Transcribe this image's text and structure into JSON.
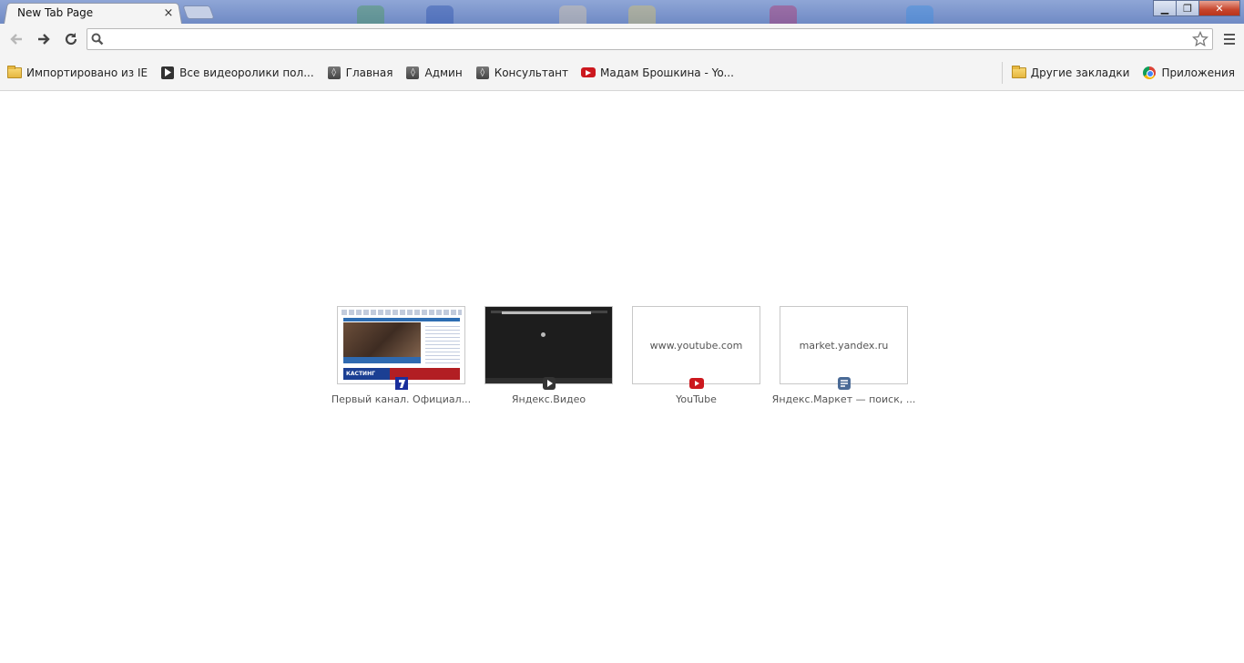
{
  "window": {
    "tab_title": "New Tab Page",
    "tab_close": "×",
    "minimize": "▁",
    "maximize": "❐",
    "close": "✕"
  },
  "toolbar": {
    "omnibox_value": "",
    "omnibox_placeholder": ""
  },
  "bookmarks": {
    "items": [
      {
        "label": "Импортировано из IE",
        "icon": "folder-icon"
      },
      {
        "label": "Все видеоролики пол...",
        "icon": "video-play-icon"
      },
      {
        "label": "Главная",
        "icon": "site-icon"
      },
      {
        "label": "Админ",
        "icon": "site-icon"
      },
      {
        "label": "Консультант",
        "icon": "site-icon"
      },
      {
        "label": "Мадам Брошкина - Yo...",
        "icon": "youtube-icon"
      }
    ],
    "other": {
      "label": "Другие закладки",
      "icon": "folder-icon"
    },
    "apps": {
      "label": "Приложения",
      "icon": "apps-icon"
    }
  },
  "most_visited": [
    {
      "title": "Первый канал. Официал...",
      "thumb_url": "",
      "favicon": "perviy-kanal-icon",
      "banner": "КАСТИНГ"
    },
    {
      "title": "Яндекс.Видео",
      "thumb_url": "",
      "favicon": "video-play-icon"
    },
    {
      "title": "YouTube",
      "thumb_url": "www.youtube.com",
      "favicon": "youtube-icon"
    },
    {
      "title": "Яндекс.Маркет — поиск, ...",
      "thumb_url": "market.yandex.ru",
      "favicon": "yandex-market-icon"
    }
  ],
  "colors": {
    "youtube_red": "#cc181e",
    "chrome_frame": "#7c95cc",
    "toolbar_bg": "#f4f4f4"
  }
}
